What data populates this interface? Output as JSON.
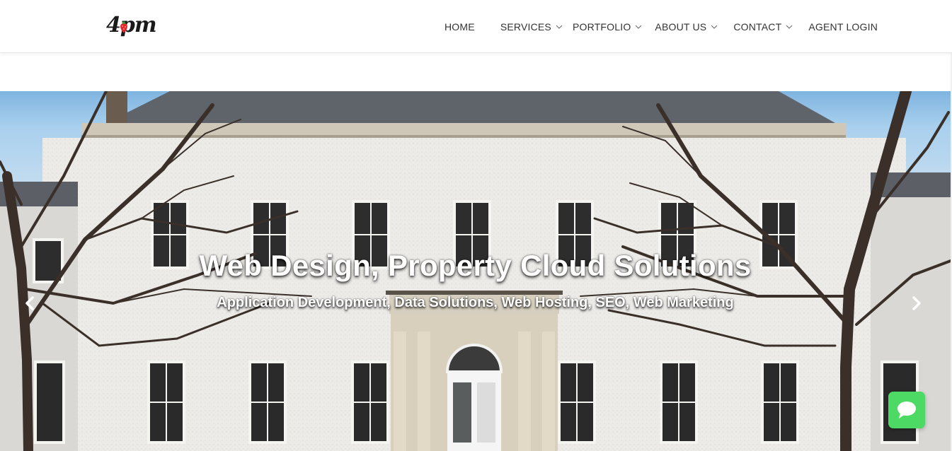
{
  "brand": {
    "logo_text": "4pm"
  },
  "nav": {
    "items": [
      {
        "label": "HOME",
        "has_dropdown": false
      },
      {
        "label": "SERVICES",
        "has_dropdown": true
      },
      {
        "label": "PORTFOLIO",
        "has_dropdown": true
      },
      {
        "label": "ABOUT US",
        "has_dropdown": true
      },
      {
        "label": "CONTACT",
        "has_dropdown": true
      },
      {
        "label": "AGENT LOGIN",
        "has_dropdown": false
      }
    ]
  },
  "hero": {
    "title": "Web Design, Property Cloud Solutions",
    "subtitle": "Application Development, Data Solutions, Web Hosting, SEO, Web Marketing",
    "prev_icon": "chevron-left-icon",
    "next_icon": "chevron-right-icon"
  },
  "chat": {
    "icon": "chat-bubble-icon",
    "color": "#4cd964"
  },
  "colors": {
    "nav_text": "#333333",
    "accent_green": "#4cd964",
    "hero_text": "#ffffff"
  }
}
